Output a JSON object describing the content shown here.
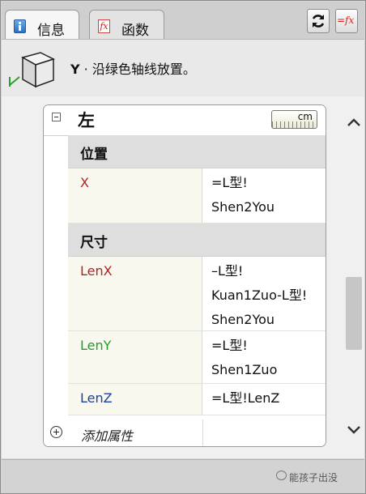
{
  "tabs": [
    {
      "label": "信息",
      "icon": "info-icon",
      "active": true
    },
    {
      "label": "函数",
      "icon": "function-icon",
      "active": false
    }
  ],
  "toolbar": {
    "refresh_icon": "refresh-icon",
    "fx_label": "=fx"
  },
  "header": {
    "axis": "Y",
    "text": " · 沿绿色轴线放置。",
    "icon": "component-cube-icon"
  },
  "component": {
    "title": "左",
    "unit": "cm",
    "sections": [
      {
        "label": "位置",
        "rows": [
          {
            "name": "X",
            "color": "#b22222",
            "value": "=L型!\nShen2You"
          }
        ]
      },
      {
        "label": "尺寸",
        "rows": [
          {
            "name": "LenX",
            "color": "#b22222",
            "value": "–L型!\nKuan1Zuo-L型!\nShen2You"
          },
          {
            "name": "LenY",
            "color": "#1e9e2a",
            "value": "=L型!\nShen1Zuo"
          },
          {
            "name": "LenZ",
            "color": "#1f3f9e",
            "value": "=L型!LenZ"
          }
        ]
      }
    ],
    "add_attribute_label": "添加属性"
  },
  "watermark": "能孩子出没"
}
